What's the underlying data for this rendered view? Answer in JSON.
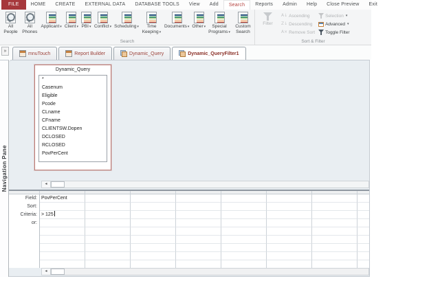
{
  "icons": {
    "caret": "▾",
    "shutter": "»",
    "scroll_left": "◂"
  },
  "colors": {
    "file_tab": "#a6383c",
    "active_ribbon_tab_text": "#b5423e",
    "doc_tab_text": "#9c423a",
    "design_background": "#e9eef2",
    "field_list_border": "#bb7a75"
  },
  "ribbon_tabs": [
    {
      "label": "FILE",
      "style": "file"
    },
    {
      "label": "HOME"
    },
    {
      "label": "CREATE"
    },
    {
      "label": "EXTERNAL DATA"
    },
    {
      "label": "DATABASE TOOLS"
    },
    {
      "label": "View"
    },
    {
      "label": "Add"
    },
    {
      "label": "Search",
      "style": "active-red"
    },
    {
      "label": "Reports"
    },
    {
      "label": "Admin"
    },
    {
      "label": "Help"
    },
    {
      "label": "Close Preview"
    },
    {
      "label": "Exit"
    }
  ],
  "ribbon": {
    "search_group": {
      "label": "Search",
      "buttons": [
        {
          "label": "All People",
          "icon": "search-table"
        },
        {
          "label": "All Phones",
          "icon": "search-table"
        },
        {
          "label": "Applicant",
          "icon": "table",
          "caret": true
        },
        {
          "label": "Client",
          "icon": "table",
          "caret": true
        },
        {
          "label": "PBI",
          "icon": "table",
          "caret": true
        },
        {
          "label": "Conflict",
          "icon": "table",
          "caret": true
        },
        {
          "label": "Scheduling",
          "icon": "table",
          "caret": true
        },
        {
          "label": "Time Keeping",
          "icon": "table",
          "caret": true
        },
        {
          "label": "Documents",
          "icon": "table",
          "caret": true
        },
        {
          "label": "Other",
          "icon": "table",
          "caret": true
        },
        {
          "label": "Special Programs",
          "icon": "table",
          "caret": true
        },
        {
          "label": "Custom Search",
          "icon": "table"
        }
      ]
    },
    "sort_filter_group": {
      "label": "Sort & Filter",
      "filter_button": {
        "label": "Filter",
        "disabled": true
      },
      "sort_items": [
        {
          "label": "Ascending",
          "glyph": "A↓",
          "disabled": true
        },
        {
          "label": "Descending",
          "glyph": "Z↓",
          "disabled": true
        },
        {
          "label": "Remove Sort",
          "glyph": "A×",
          "disabled": true
        }
      ],
      "filter_items": [
        {
          "label": "Selection",
          "glyph": "shape:funnel",
          "caret": true,
          "disabled": true
        },
        {
          "label": "Advanced",
          "glyph": "shape:window",
          "caret": true,
          "disabled": false
        },
        {
          "label": "Toggle Filter",
          "glyph": "shape:funnel",
          "disabled": false
        }
      ]
    }
  },
  "doc_bar": {
    "tabs": [
      {
        "label": "mnuTouch",
        "icon": "form",
        "active": false
      },
      {
        "label": "Report Builder",
        "icon": "form",
        "active": false
      },
      {
        "label": "Dynamic_Query",
        "icon": "query",
        "active": false
      },
      {
        "label": "Dynamic_QueryFilter1",
        "icon": "query",
        "active": true
      }
    ]
  },
  "navigation_pane": {
    "label": "Navigation Pane"
  },
  "query_design": {
    "field_list": {
      "title": "Dynamic_Query",
      "fields": [
        "*",
        "Casenum",
        "Eligible",
        "Pcode",
        "CLname",
        "CFname",
        "CLIENTSW.Dopen",
        "DCLOSED",
        "RCLOSED",
        "PovPerCent"
      ]
    },
    "grid": {
      "row_labels": [
        "Field:",
        "Sort:",
        "Criteria:",
        "or:"
      ],
      "columns": 8,
      "empty_rows": 5,
      "cells": [
        {
          "row": 0,
          "col": 0,
          "value": "PovPerCent"
        },
        {
          "row": 2,
          "col": 0,
          "value": "> 125",
          "cursor": true
        }
      ]
    }
  }
}
